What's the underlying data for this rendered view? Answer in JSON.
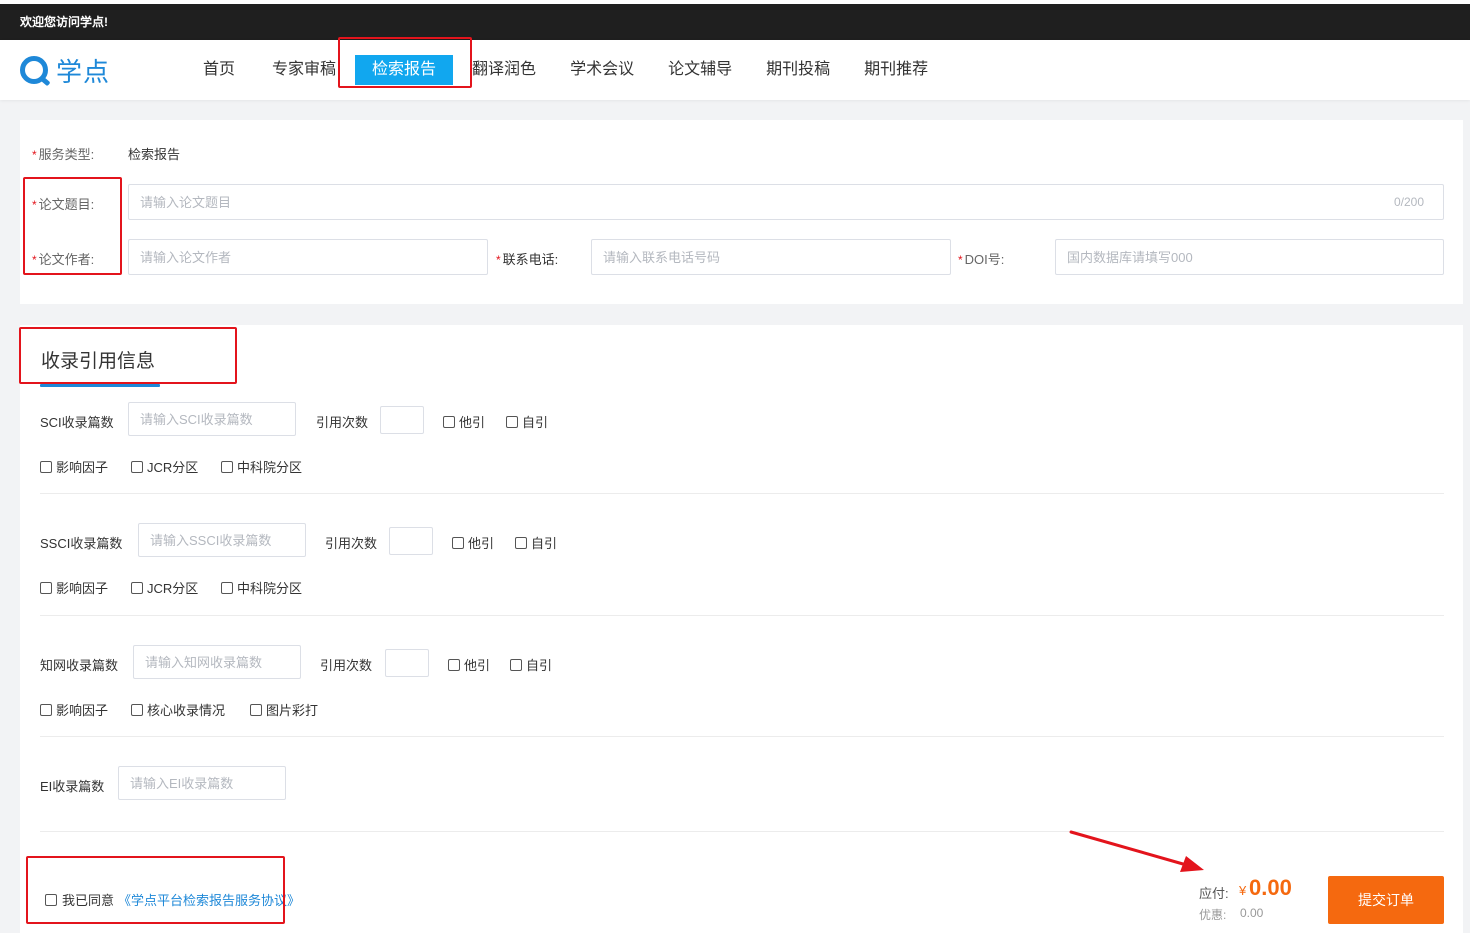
{
  "topbar": {
    "welcome": "欢迎您访问学点!"
  },
  "header": {
    "logo_text": "学点",
    "nav": [
      {
        "label": "首页"
      },
      {
        "label": "专家审稿"
      },
      {
        "label": "检索报告",
        "active": true
      },
      {
        "label": "翻译润色"
      },
      {
        "label": "学术会议"
      },
      {
        "label": "论文辅导"
      },
      {
        "label": "期刊投稿"
      },
      {
        "label": "期刊推荐"
      }
    ]
  },
  "form": {
    "service_type_label": "服务类型:",
    "service_type_value": "检索报告",
    "title_label": "论文题目:",
    "title_placeholder": "请输入论文题目",
    "title_counter": "0/200",
    "author_label": "论文作者:",
    "author_placeholder": "请输入论文作者",
    "phone_label": "联系电话:",
    "phone_placeholder": "请输入联系电话号码",
    "doi_label": "DOI号:",
    "doi_placeholder": "国内数据库请填写000"
  },
  "citation": {
    "section_title": "收录引用信息",
    "sci": {
      "label": "SCI收录篇数",
      "placeholder": "请输入SCI收录篇数",
      "cite_label": "引用次数",
      "other_cite": "他引",
      "self_cite": "自引",
      "options": [
        "影响因子",
        "JCR分区",
        "中科院分区"
      ]
    },
    "ssci": {
      "label": "SSCI收录篇数",
      "placeholder": "请输入SSCI收录篇数",
      "cite_label": "引用次数",
      "other_cite": "他引",
      "self_cite": "自引",
      "options": [
        "影响因子",
        "JCR分区",
        "中科院分区"
      ]
    },
    "cnki": {
      "label": "知网收录篇数",
      "placeholder": "请输入知网收录篇数",
      "cite_label": "引用次数",
      "other_cite": "他引",
      "self_cite": "自引",
      "options": [
        "影响因子",
        "核心收录情况",
        "图片彩打"
      ]
    },
    "ei": {
      "label": "EI收录篇数",
      "placeholder": "请输入EI收录篇数"
    }
  },
  "footer": {
    "agree_text": "我已同意",
    "agree_link": "《学点平台检索报告服务协议》",
    "pay_label": "应付:",
    "currency": "¥",
    "pay_amount": "0.00",
    "discount_label": "优惠:",
    "discount_amount": "0.00",
    "submit_label": "提交订单"
  },
  "colors": {
    "accent": "#1e88d8",
    "nav_active": "#11a7ef",
    "submit": "#f5690f",
    "annotation": "#e3141c",
    "topbar": "#1f1f1f"
  }
}
